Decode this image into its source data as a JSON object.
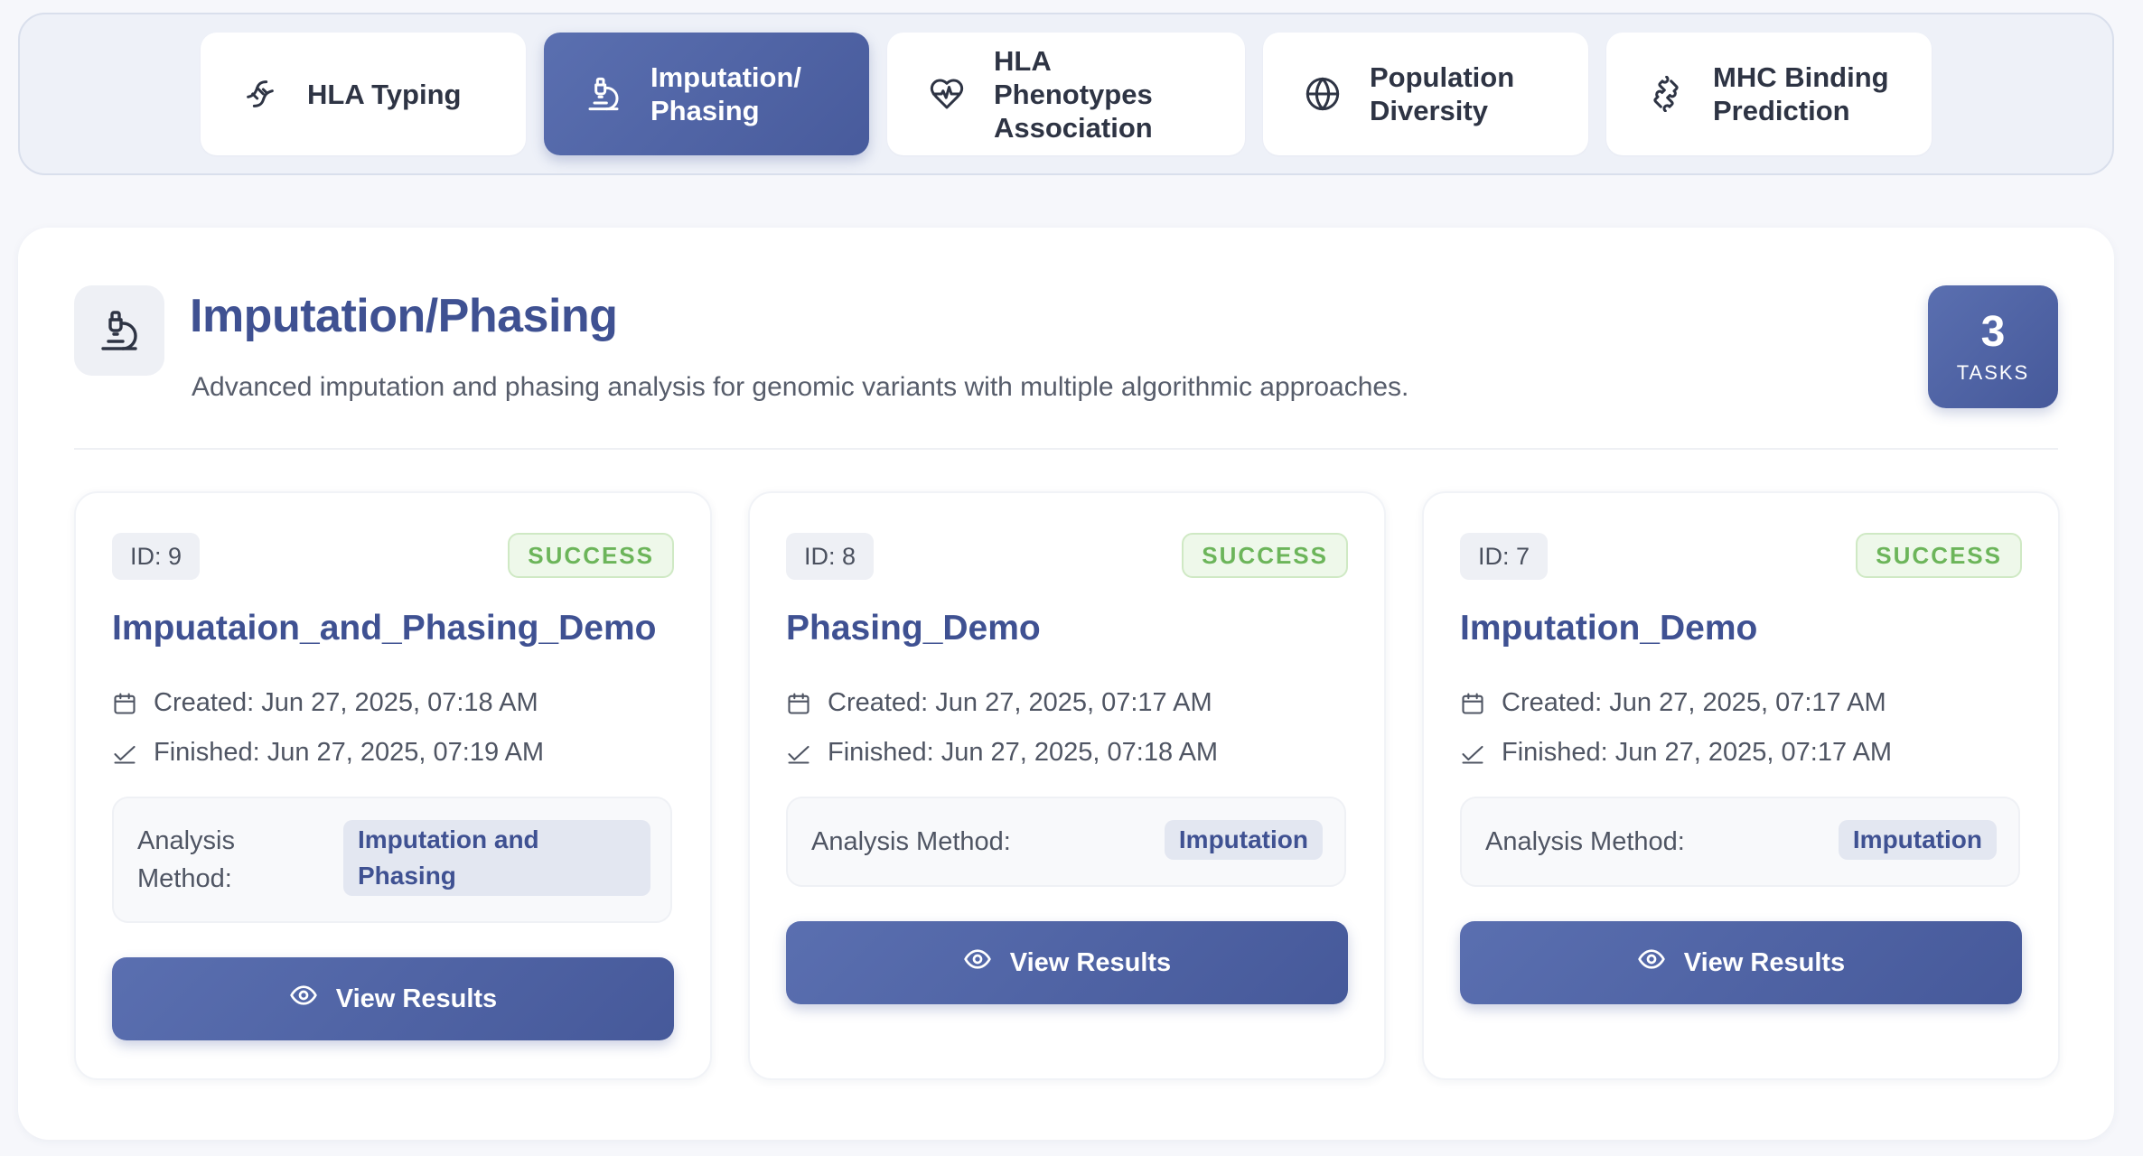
{
  "tabs": [
    {
      "label": "HLA Typing",
      "icon": "dna-icon",
      "active": false
    },
    {
      "label": "Imputation/\nPhasing",
      "icon": "microscope-icon",
      "active": true
    },
    {
      "label": "HLA Phenotypes\nAssociation",
      "icon": "heart-pulse-icon",
      "active": false
    },
    {
      "label": "Population\nDiversity",
      "icon": "globe-icon",
      "active": false
    },
    {
      "label": "MHC Binding\nPrediction",
      "icon": "puzzle-icon",
      "active": false
    }
  ],
  "header": {
    "icon": "microscope-icon",
    "title": "Imputation/Phasing",
    "description": "Advanced imputation and phasing analysis for genomic variants with multiple algorithmic approaches.",
    "task_count": "3",
    "task_count_label": "TASKS"
  },
  "tasks": [
    {
      "id": "ID: 9",
      "status": "SUCCESS",
      "name": "Impuataion_and_Phasing_Demo",
      "created": "Created: Jun 27, 2025, 07:18 AM",
      "finished": "Finished: Jun 27, 2025, 07:19 AM",
      "method_label": "Analysis Method:",
      "method": "Imputation and Phasing",
      "button": "View Results"
    },
    {
      "id": "ID: 8",
      "status": "SUCCESS",
      "name": "Phasing_Demo",
      "created": "Created: Jun 27, 2025, 07:17 AM",
      "finished": "Finished: Jun 27, 2025, 07:18 AM",
      "method_label": "Analysis Method:",
      "method": "Imputation",
      "button": "View Results"
    },
    {
      "id": "ID: 7",
      "status": "SUCCESS",
      "name": "Imputation_Demo",
      "created": "Created: Jun 27, 2025, 07:17 AM",
      "finished": "Finished: Jun 27, 2025, 07:17 AM",
      "method_label": "Analysis Method:",
      "method": "Imputation",
      "button": "View Results"
    }
  ],
  "colors": {
    "accent": "#4d61a3",
    "title": "#3f5192",
    "success": "#6cb55a",
    "success_bg": "#eef8ea"
  }
}
